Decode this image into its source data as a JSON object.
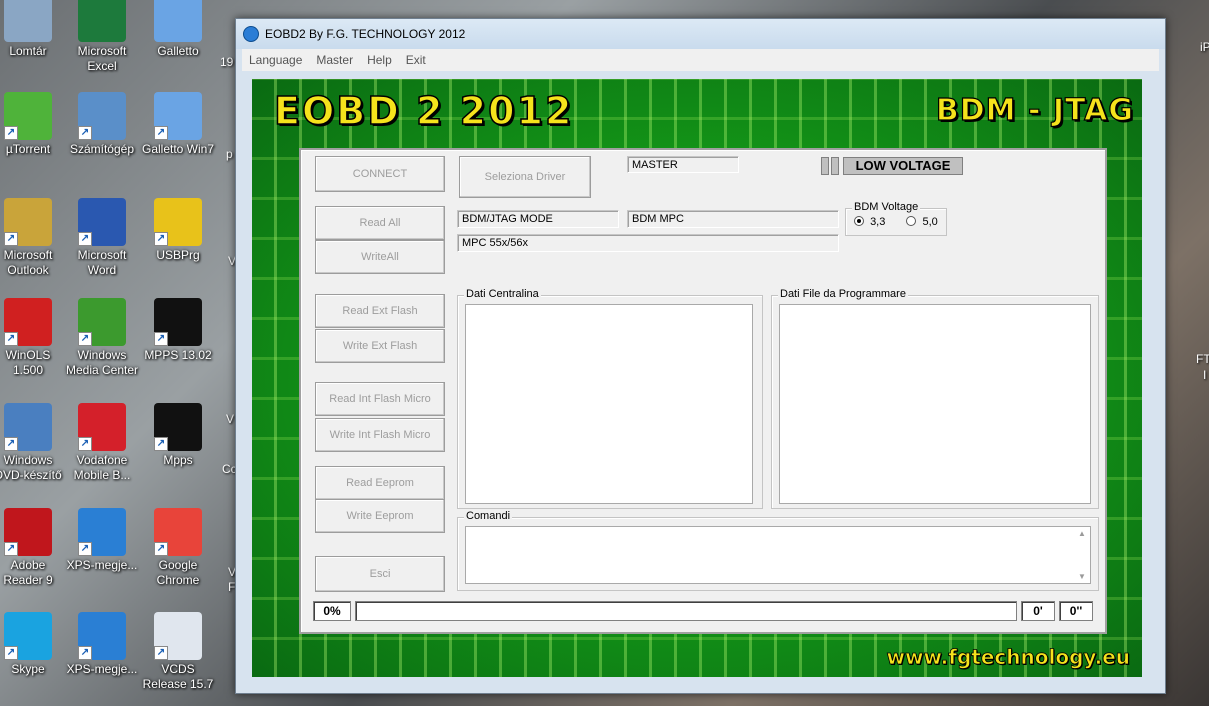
{
  "desktop": {
    "icons": [
      {
        "label": "Lomtár",
        "icon": "recycle-bin-icon",
        "color": "#8aa6c4"
      },
      {
        "label": "Microsoft Excel",
        "icon": "excel-icon",
        "color": "#1d7a3c"
      },
      {
        "label": "Galletto",
        "icon": "galletto-icon",
        "color": "#6aa4e4"
      },
      {
        "label": "µTorrent",
        "icon": "utorrent-icon",
        "color": "#4fb33a"
      },
      {
        "label": "Számítógép",
        "icon": "computer-icon",
        "color": "#5a8fc9"
      },
      {
        "label": "Galletto Win7",
        "icon": "galletto-icon",
        "color": "#6aa4e4"
      },
      {
        "label": "Microsoft Outlook",
        "icon": "outlook-icon",
        "color": "#c9a43a"
      },
      {
        "label": "Microsoft Word",
        "icon": "word-icon",
        "color": "#2a58b0"
      },
      {
        "label": "USBPrg",
        "icon": "usbprg-icon",
        "color": "#e8c21a"
      },
      {
        "label": "WinOLS 1.500",
        "icon": "winols-icon",
        "color": "#d02020"
      },
      {
        "label": "Windows Media Center",
        "icon": "media-center-icon",
        "color": "#3c9a2e"
      },
      {
        "label": "MPPS 13.02",
        "icon": "mpps-icon",
        "color": "#111111"
      },
      {
        "label": "Windows DVD-készítő",
        "icon": "dvd-maker-icon",
        "color": "#4a7fc0"
      },
      {
        "label": "Vodafone Mobile B...",
        "icon": "vodafone-icon",
        "color": "#d4202a"
      },
      {
        "label": "Mpps",
        "icon": "mpps-icon",
        "color": "#111111"
      },
      {
        "label": "Adobe Reader 9",
        "icon": "adobe-reader-icon",
        "color": "#c0161c"
      },
      {
        "label": "XPS-megje...",
        "icon": "xps-viewer-icon",
        "color": "#2a7fd4"
      },
      {
        "label": "Google Chrome",
        "icon": "chrome-icon",
        "color": "#e8443a"
      },
      {
        "label": "Skype",
        "icon": "skype-icon",
        "color": "#1aa3e0"
      },
      {
        "label": "XPS-megje...",
        "icon": "xps-viewer-icon",
        "color": "#2a7fd4"
      },
      {
        "label": "VCDS Release 15.7",
        "icon": "vcds-icon",
        "color": "#e0e6ee"
      }
    ],
    "edge_texts": [
      "19",
      "p",
      "V",
      "V",
      "Cc",
      "V",
      "F",
      "iP",
      "FT",
      "I"
    ]
  },
  "window": {
    "title": "EOBD2 By F.G. TECHNOLOGY 2012",
    "menu": [
      "Language",
      "Master",
      "Help",
      "Exit"
    ],
    "banner_left": "EOBD 2 2012",
    "banner_right": "BDM - JTAG",
    "website": "www.fgtechnology.eu",
    "buttons": {
      "connect": "CONNECT",
      "select_driver": "Seleziona Driver",
      "read_all": "Read All",
      "write_all": "WriteAll",
      "read_ext_flash": "Read Ext Flash",
      "write_ext_flash": "Write Ext Flash",
      "read_int_flash": "Read Int Flash Micro",
      "write_int_flash": "Write Int Flash Micro",
      "read_eeprom": "Read Eeprom",
      "write_eeprom": "Write Eeprom",
      "exit": "Esci"
    },
    "labels": {
      "master": "MASTER",
      "low_voltage": "LOW VOLTAGE",
      "mode": "BDM/JTAG  MODE",
      "protocol": "BDM MPC",
      "ecu": "MPC 55x/56x"
    },
    "bdm_voltage": {
      "title": "BDM Voltage",
      "options": [
        "3,3",
        "5,0"
      ],
      "selected": "3,3"
    },
    "groups": {
      "ecu_data": "Dati Centralina",
      "file_data": "Dati File da Programmare",
      "commands": "Comandi"
    },
    "status": {
      "percent": "0%",
      "minutes": "0'",
      "seconds": "0''"
    },
    "colors": {
      "banner_yellow": "#f5e31c",
      "pcb_green": "#149a18"
    }
  }
}
